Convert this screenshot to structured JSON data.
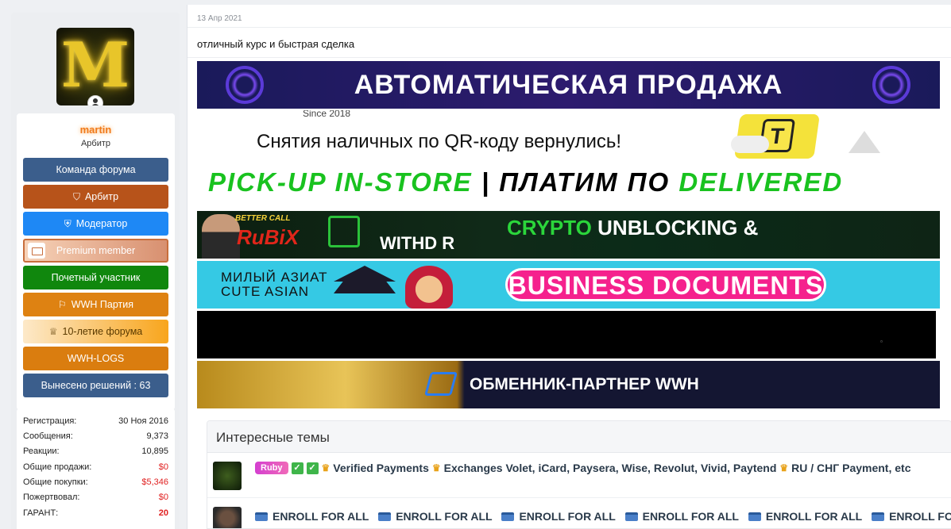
{
  "user": {
    "name": "martin",
    "title": "Арбитр",
    "avatar_letter": "M",
    "banners": [
      {
        "label": "Команда форума",
        "icon": ""
      },
      {
        "label": "Арбитр",
        "icon": "shield-icon"
      },
      {
        "label": "Модератор",
        "icon": "shield-check-icon"
      },
      {
        "label": "Premium member",
        "icon": "card-icon"
      },
      {
        "label": "Почетный участник",
        "icon": ""
      },
      {
        "label": "WWH Партия",
        "icon": "flag-icon"
      },
      {
        "label": "10-летие форума",
        "icon": "trophy-icon"
      },
      {
        "label": "WWH-LOGS",
        "icon": ""
      },
      {
        "label": "Вынесено решений : 63",
        "icon": ""
      }
    ],
    "stats": [
      {
        "label": "Регистрация:",
        "value": "30 Ноя 2016"
      },
      {
        "label": "Сообщения:",
        "value": "9,373"
      },
      {
        "label": "Реакции:",
        "value": "10,895"
      },
      {
        "label": "Общие продажи:",
        "value": "$0"
      },
      {
        "label": "Общие покупки:",
        "value": "$5,346"
      },
      {
        "label": "Пожертвовал:",
        "value": "$0"
      },
      {
        "label": "ГАРАНТ:",
        "value": "20"
      }
    ]
  },
  "post": {
    "date": "13 Апр 2021",
    "text": "отличный курс и быстрая сделка"
  },
  "ads": {
    "ad1": "АВТОМАТИЧЕСКАЯ ПРОДАЖА",
    "ad2_since": "Since 2018",
    "ad2": "Снятия наличных по QR-коду вернулись!",
    "ad2_tag": "T",
    "ad3_a": "PICK-UP IN-STORE",
    "ad3_sep": " | ",
    "ad3_b": "ПЛАТИМ ПО ",
    "ad3_c": "DELIVERED",
    "ad4_better": "BETTER CALL",
    "ad4_rubix": "RuBiX",
    "ad4_with": "WITHD  R",
    "ad4_crypto_a": "CRYPTO",
    "ad4_crypto_b": " UNBLOCKING &",
    "ad5_asia_1": "МИЛЫЙ АЗИАТ",
    "ad5_asia_2": "CUTE ASIAN",
    "ad5": "BUSINESS DOCUMENTS",
    "ad7": "ОБМЕННИК-ПАРТНЕР WWH"
  },
  "threads": {
    "title": "Интересные темы",
    "row1": {
      "badge": "Ruby",
      "text1": "Verified Payments",
      "text2": "Exchanges Volet, iCard, Paysera, Wise, Revolut, Vivid, Paytend",
      "text3": "RU / СНГ Payment, etc"
    },
    "row2": {
      "item": "ENROLL FOR ALL"
    }
  }
}
